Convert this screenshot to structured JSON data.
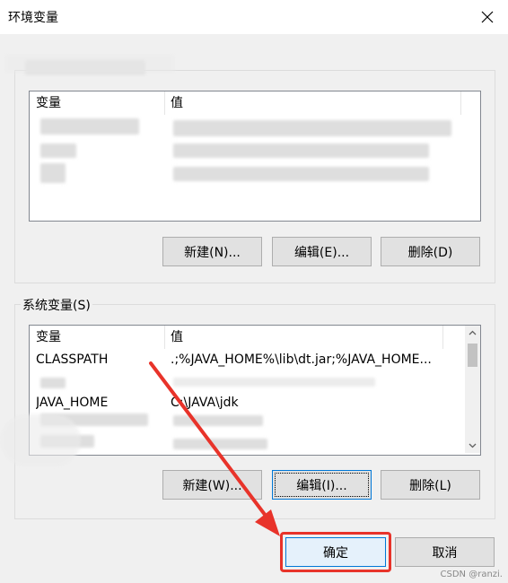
{
  "window": {
    "title": "环境变量"
  },
  "user_vars": {
    "columns": [
      "变量",
      "值"
    ],
    "buttons": {
      "new": "新建(N)...",
      "edit": "编辑(E)...",
      "delete": "删除(D)"
    }
  },
  "system_vars": {
    "label": "系统变量(S)",
    "columns": [
      "变量",
      "值"
    ],
    "rows": [
      {
        "name": "CLASSPATH",
        "value": ".;%JAVA_HOME%\\lib\\dt.jar;%JAVA_HOME..."
      },
      {
        "name": "JAVA_HOME",
        "value": "C:\\JAVA\\jdk"
      }
    ],
    "buttons": {
      "new": "新建(W)...",
      "edit": "编辑(I)...",
      "delete": "删除(L)"
    }
  },
  "footer": {
    "ok": "确定",
    "cancel": "取消"
  },
  "annotation": {
    "color": "#e8332a"
  },
  "watermark": "CSDN @ranzi."
}
